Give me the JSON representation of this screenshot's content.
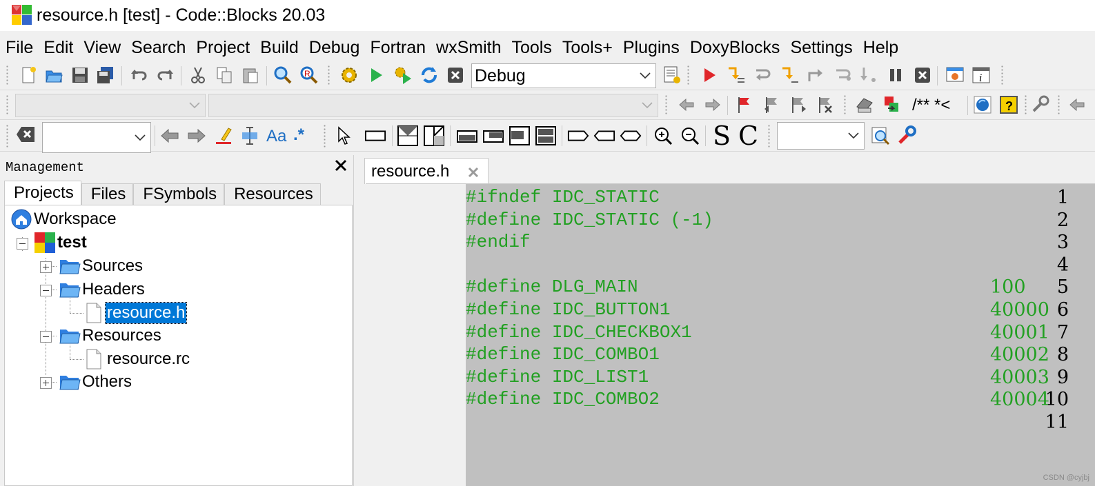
{
  "window": {
    "title": "resource.h [test] - Code::Blocks 20.03"
  },
  "menu": [
    "File",
    "Edit",
    "View",
    "Search",
    "Project",
    "Build",
    "Debug",
    "Fortran",
    "wxSmith",
    "Tools",
    "Tools+",
    "Plugins",
    "DoxyBlocks",
    "Settings",
    "Help"
  ],
  "toolbar": {
    "build_target": "Debug",
    "doxyblocks_comment_label": "/** *<",
    "search_combo_value": "",
    "scope_combo_value": "",
    "function_combo_value": "",
    "text_icon_match_case": "Aa",
    "text_icon_regex": ".*",
    "text_icon_s": "S",
    "text_icon_c": "C",
    "wx_combo_value": ""
  },
  "management": {
    "title": "Management",
    "tabs": [
      "Projects",
      "Files",
      "FSymbols",
      "Resources"
    ],
    "active_tab": "Projects",
    "tree": {
      "workspace": "Workspace",
      "project": "test",
      "folders": [
        {
          "name": "Sources",
          "expanded": false,
          "files": []
        },
        {
          "name": "Headers",
          "expanded": true,
          "files": [
            "resource.h"
          ]
        },
        {
          "name": "Resources",
          "expanded": true,
          "files": [
            "resource.rc"
          ]
        },
        {
          "name": "Others",
          "expanded": false,
          "files": []
        }
      ],
      "selected": "resource.h"
    }
  },
  "editor": {
    "tab": "resource.h",
    "lines": [
      {
        "n": "1",
        "code": "#ifndef IDC_STATIC",
        "value": ""
      },
      {
        "n": "2",
        "code": "#define IDC_STATIC (-1)",
        "value": ""
      },
      {
        "n": "3",
        "code": "#endif",
        "value": ""
      },
      {
        "n": "4",
        "code": "",
        "value": ""
      },
      {
        "n": "5",
        "code": "#define DLG_MAIN",
        "value": "100"
      },
      {
        "n": "6",
        "code": "#define IDC_BUTTON1",
        "value": "40000"
      },
      {
        "n": "7",
        "code": "#define IDC_CHECKBOX1",
        "value": "40001"
      },
      {
        "n": "8",
        "code": "#define IDC_COMBO1",
        "value": "40002"
      },
      {
        "n": "9",
        "code": "#define IDC_LIST1",
        "value": "40003"
      },
      {
        "n": "10",
        "code": "#define IDC_COMBO2",
        "value": "40004"
      },
      {
        "n": "11",
        "code": "",
        "value": ""
      }
    ]
  },
  "watermark": "CSDN @cyjbj",
  "colors": {
    "code_text": "#22a022",
    "code_background": "#c0c0c0",
    "selection": "#0078d7"
  }
}
